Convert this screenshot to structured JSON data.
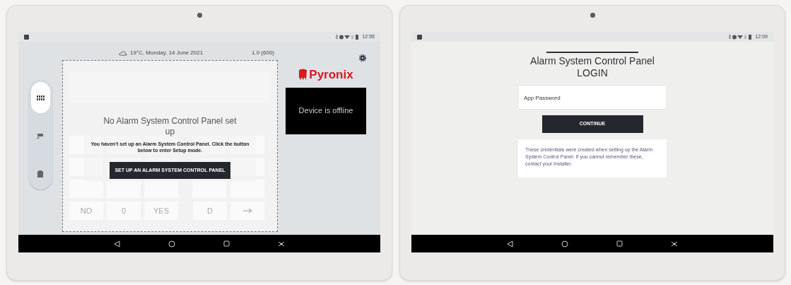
{
  "tablets": [
    {
      "kind": "home",
      "status_time": "12:55",
      "weather": "19°C, Monday, 14 June 2021",
      "version": "1.0 (600)",
      "sidebar": {
        "items": [
          {
            "kind": "keypad",
            "selected": true
          },
          {
            "kind": "cctv",
            "selected": false
          },
          {
            "kind": "building",
            "selected": false
          }
        ]
      },
      "keypad_bottom_row": [
        {
          "kind": "text",
          "label": "NO"
        },
        {
          "kind": "text",
          "label": "0"
        },
        {
          "kind": "text",
          "label": "YES"
        },
        {
          "kind": "text",
          "label": "D"
        },
        {
          "kind": "next"
        }
      ],
      "message": {
        "title": "No Alarm System Control Panel set up",
        "body": "You haven't set up an Alarm System Control Panel. Click the button below to enter Setup mode.",
        "button": "SET UP AN ALARM SYSTEM CONTROL PANEL"
      },
      "brand": "Pyronix",
      "device_status": "Device is offline"
    },
    {
      "kind": "login",
      "status_time": "12:09",
      "title": "Alarm System Control Panel",
      "subtitle": "LOGIN",
      "password": {
        "placeholder": "App Password"
      },
      "button": "CONTINUE",
      "note": "These credentials were created when setting up the Alarm System Control Panel. If you cannot remember these, contact your Installer."
    }
  ]
}
